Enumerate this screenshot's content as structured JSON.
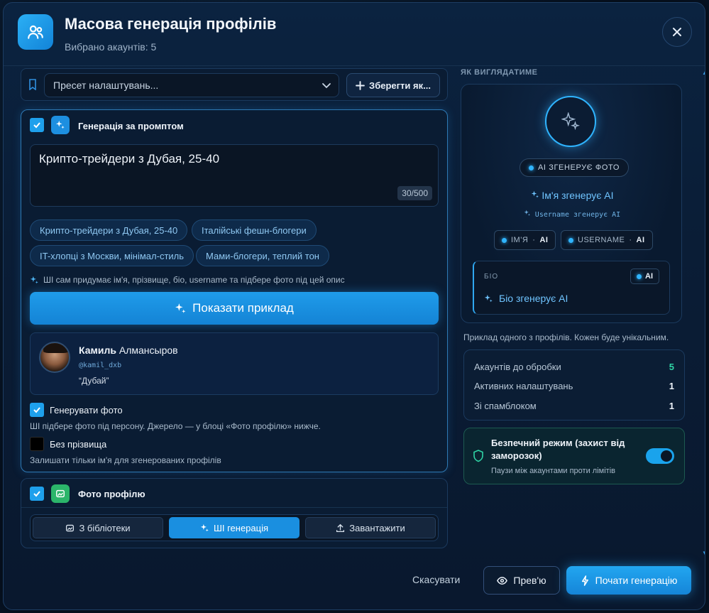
{
  "header": {
    "title": "Масова генерація профілів",
    "subtitle": "Вибрано акаунтів: 5"
  },
  "preset": {
    "placeholder": "Пресет налаштувань...",
    "save_label": "Зберегти як..."
  },
  "prompt_section": {
    "title": "Генерація за промптом",
    "prompt_value": "Крипто-трейдери з Дубая, 25-40",
    "counter": "30/500",
    "chips": [
      "Крипто-трейдери з Дубая, 25-40",
      "Італійські фешн-блогери",
      "IT-хлопці з Москви, мінімал-стиль",
      "Мами-блогери, теплий тон"
    ],
    "hint": "ШІ сам придумає ім'я, прізвище, біо, username та підбере фото під цей опис",
    "show_example_label": "Показати приклад",
    "profile": {
      "first_name": "Камиль",
      "last_name": "Алмансыров",
      "handle": "@kamil_dxb",
      "bio": "“Дубай”"
    },
    "gen_photo_label": "Генерувати фото",
    "gen_photo_desc": "ШІ підбере фото під персону. Джерело — у блоці «Фото профілю» нижче.",
    "no_surname_label": "Без прізвища",
    "no_surname_desc": "Залишати тільки ім'я для згенерованих профілів"
  },
  "photo_section": {
    "title": "Фото профілю",
    "options": [
      "З бібліотеки",
      "ШІ генерація",
      "Завантажити"
    ],
    "active_option": "ШІ генерація"
  },
  "preview": {
    "title": "ЯК ВИГЛЯДАТИМЕ",
    "photo_badge": "AI ЗГЕНЕРУЄ ФОТО",
    "name_text": "Ім'я згенерує AI",
    "username_text": "Username згенерує AI",
    "tags": [
      {
        "label": "ІМ'Я",
        "value": "AI"
      },
      {
        "label": "USERNAME",
        "value": "AI"
      }
    ],
    "bio_label": "БІО",
    "bio_badge": "AI",
    "bio_text": "Біо згенерує AI",
    "note": "Приклад одного з профілів. Кожен буде унікальним."
  },
  "stats": [
    {
      "label": "Акаунтів до обробки",
      "value": "5"
    },
    {
      "label": "Активних налаштувань",
      "value": "1"
    },
    {
      "label": "Зі спамблоком",
      "value": "1"
    }
  ],
  "safe_mode": {
    "title": "Безпечний режим (захист від заморозок)",
    "desc": "Паузи між акаунтами проти лімітів",
    "enabled": true
  },
  "footer": {
    "cancel_label": "Скасувати",
    "preview_label": "Прев'ю",
    "start_label": "Почати генерацію"
  },
  "colors": {
    "accent": "#1ea0ec",
    "success": "#2fd4a5"
  }
}
